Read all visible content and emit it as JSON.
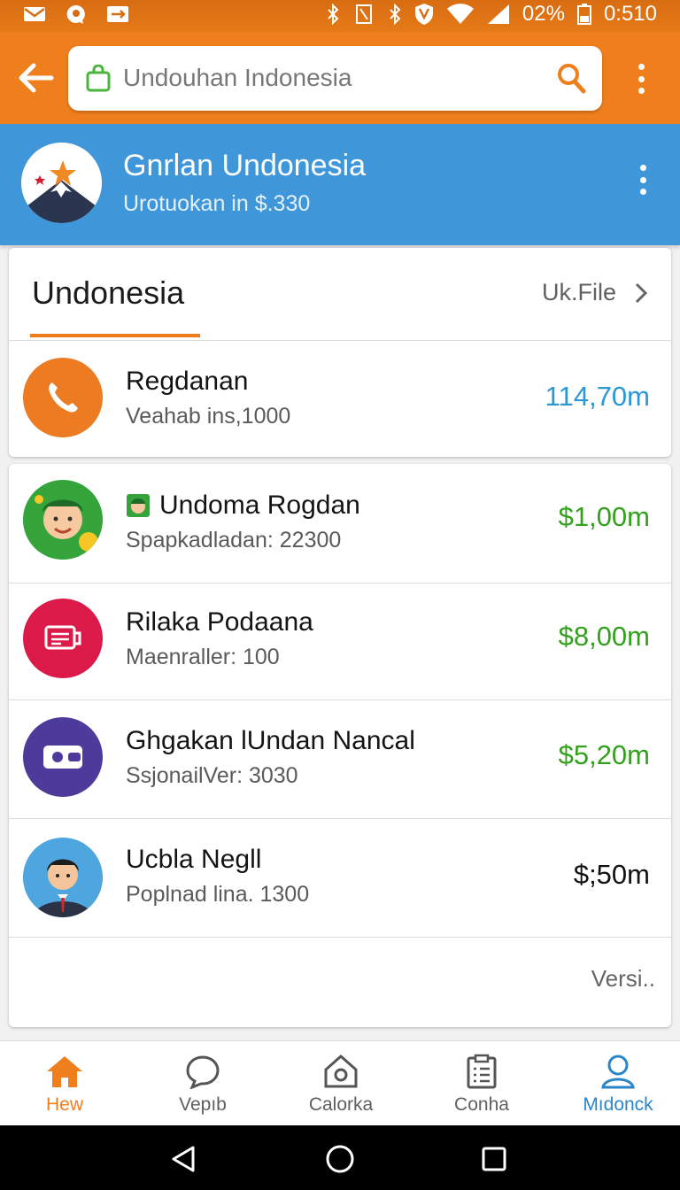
{
  "status_bar": {
    "battery": "02%",
    "time": "0:510",
    "left_icons": [
      "mail-icon",
      "messenger-icon",
      "cast-icon"
    ],
    "right_icons": [
      "bluetooth-icon",
      "nfc-icon",
      "bluetooth-icon",
      "shield-icon",
      "wifi-icon",
      "signal-icon",
      "battery-icon"
    ]
  },
  "toolbar": {
    "back_icon": "arrow-left-icon",
    "search_value": "Undouhan Indonesia",
    "search_icon": "search-icon",
    "bag_icon": "shopping-bag-icon",
    "menu_icon": "more-vertical-icon",
    "color": "#ef7e1c"
  },
  "profile": {
    "name": "Gnrlan Undonesia",
    "subtitle": "Urotuokan in $.330",
    "menu_icon": "more-vertical-icon",
    "color": "#3f97d9"
  },
  "section": {
    "title": "Undonesia",
    "link_label": "Uk.File",
    "link_icon": "chevron-right-icon"
  },
  "first_item": {
    "title": "Regdanan",
    "subtitle": "Veahab ins,1000",
    "amount": "114,70m",
    "icon": "phone-icon",
    "amount_color": "#2a98d4"
  },
  "items": [
    {
      "title": "Undoma Rogdan",
      "subtitle": "Spapkadladan: 22300",
      "amount": "$1,00m",
      "icon": "man-avatar-icon",
      "badge_icon": "face-badge-icon",
      "amount_color": "#33a11d"
    },
    {
      "title": "Rilaka Podaana",
      "subtitle": "Maenraller: 100",
      "amount": "$8,00m",
      "icon": "card-icon",
      "amount_color": "#33a11d"
    },
    {
      "title": "Ghgakan lUndan Nancal",
      "subtitle": "SsjonailVer: 3030",
      "amount": "$5,20m",
      "icon": "wallet-icon",
      "amount_color": "#33a11d"
    },
    {
      "title": "Ucbla Negll",
      "subtitle": "Poplnad lina. 1300",
      "amount": "$;50m",
      "icon": "businessman-avatar-icon",
      "amount_color": "#111111"
    }
  ],
  "footer_text": "Versi..",
  "bottom_nav": [
    {
      "label": "Hew",
      "icon": "home-icon",
      "active": true
    },
    {
      "label": "Vepıb",
      "icon": "chat-icon",
      "active": false
    },
    {
      "label": "Calorka",
      "icon": "house-outline-icon",
      "active": false
    },
    {
      "label": "Conha",
      "icon": "clipboard-icon",
      "active": false
    },
    {
      "label": "Mıdonck",
      "icon": "user-icon",
      "active": false
    }
  ],
  "system_nav": [
    "back-triangle-icon",
    "home-circle-icon",
    "recents-square-icon"
  ]
}
